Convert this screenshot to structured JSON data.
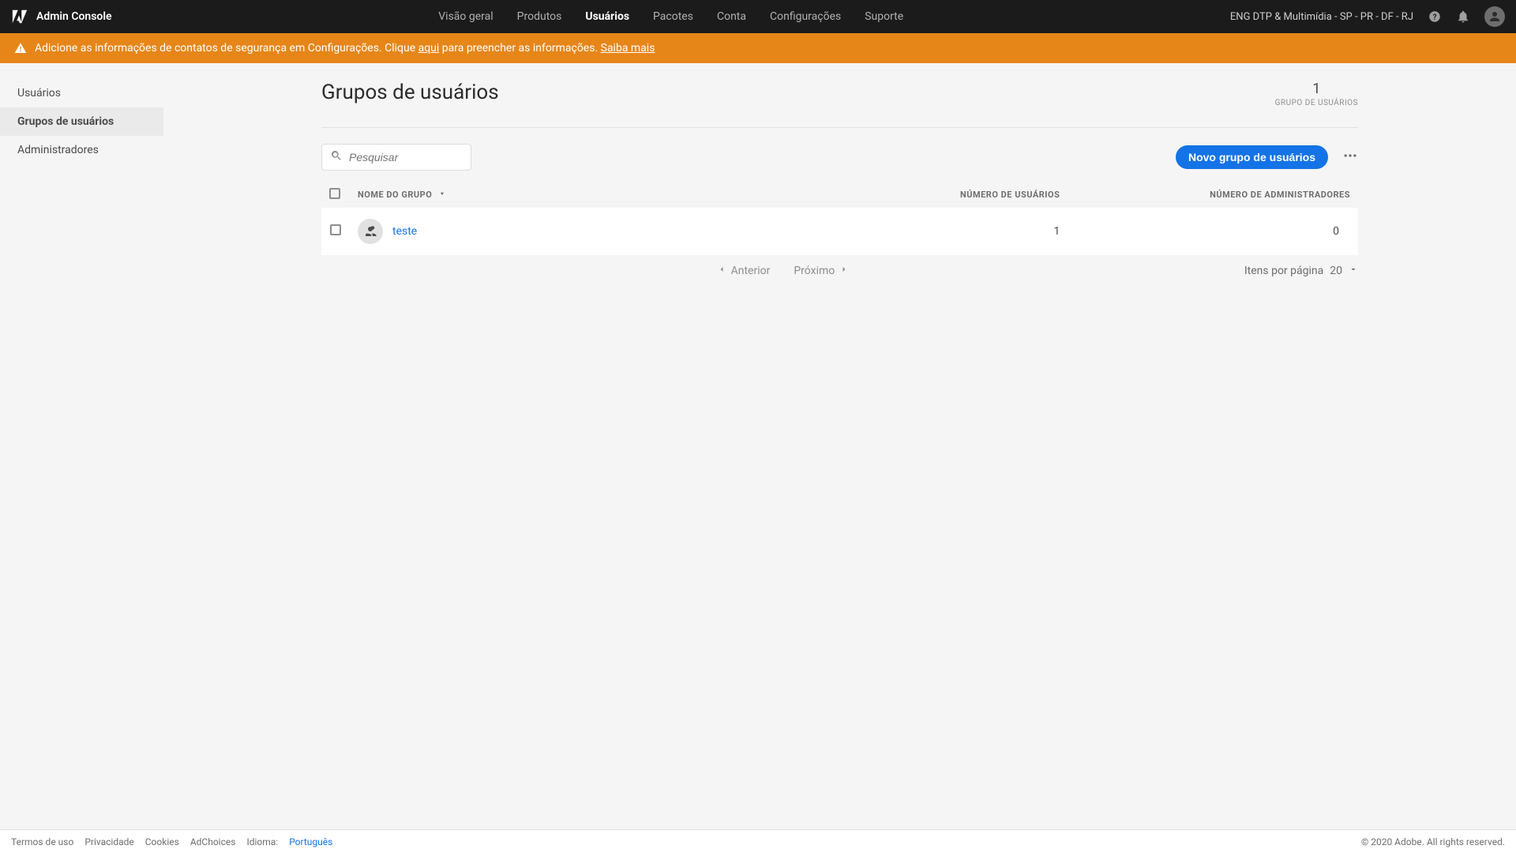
{
  "topbar": {
    "app_name": "Admin Console",
    "nav": {
      "overview": "Visão geral",
      "products": "Produtos",
      "users": "Usuários",
      "packages": "Pacotes",
      "account": "Conta",
      "settings": "Configurações",
      "support": "Suporte"
    },
    "org_name": "ENG DTP & Multimídia - SP - PR - DF - RJ"
  },
  "banner": {
    "prefix": "Adicione as informações de contatos de segurança em Configurações. Clique ",
    "link1": "aqui",
    "middle": " para preencher as informações. ",
    "link2": "Saiba mais"
  },
  "sidebar": {
    "users": "Usuários",
    "groups": "Grupos de usuários",
    "admins": "Administradores"
  },
  "page": {
    "title": "Grupos de usuários",
    "stat_number": "1",
    "stat_label": "GRUPO DE USUÁRIOS"
  },
  "toolbar": {
    "search_placeholder": "Pesquisar",
    "new_group_button": "Novo grupo de usuários"
  },
  "table": {
    "headers": {
      "name": "NOME DO GRUPO",
      "users": "NÚMERO DE USUÁRIOS",
      "admins": "NÚMERO DE ADMINISTRADORES"
    },
    "rows": [
      {
        "name": "teste",
        "users": "1",
        "admins": "0"
      }
    ]
  },
  "pagination": {
    "prev": "Anterior",
    "next": "Próximo",
    "per_page_label": "Itens por página",
    "per_page_value": "20"
  },
  "footer": {
    "terms": "Termos de uso",
    "privacy": "Privacidade",
    "cookies": "Cookies",
    "adchoices": "AdChoices",
    "language_label": "Idioma:",
    "language_value": "Português",
    "copyright": "© 2020 Adobe. All rights reserved."
  }
}
